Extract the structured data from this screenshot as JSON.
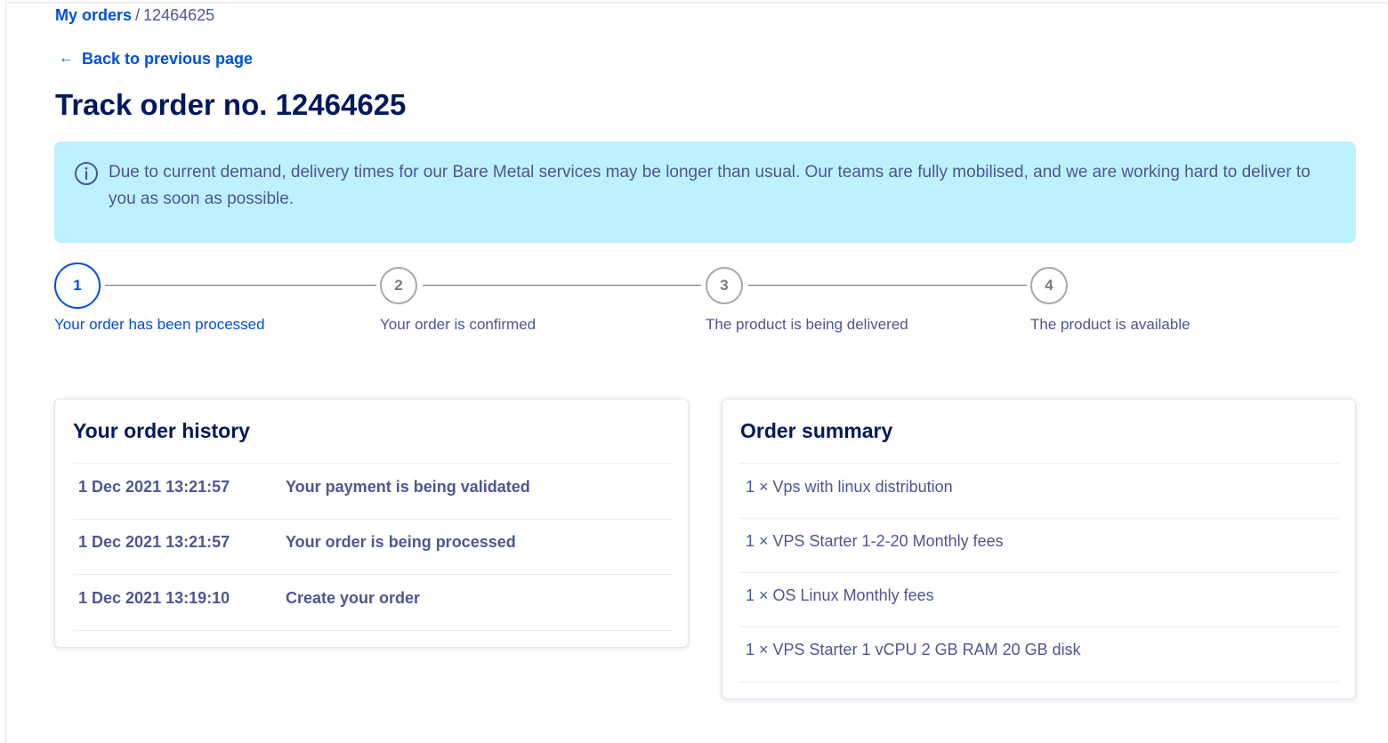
{
  "breadcrumb": {
    "root": "My orders",
    "separator": "/",
    "current": "12464625"
  },
  "back_link": {
    "icon": "arrow-left-icon",
    "label": "Back to previous page"
  },
  "page_title": "Track order no. 12464625",
  "alert": {
    "icon": "info-icon",
    "text": "Due to current demand, delivery times for our Bare Metal services may be longer than usual. Our teams are fully mobilised, and we are working hard to deliver to you as soon as possible."
  },
  "stepper": {
    "current_step": 1,
    "steps": [
      {
        "number": "1",
        "label": "Your order has been processed"
      },
      {
        "number": "2",
        "label": "Your order is confirmed"
      },
      {
        "number": "3",
        "label": "The product is being delivered"
      },
      {
        "number": "4",
        "label": "The product is available"
      }
    ]
  },
  "history": {
    "title": "Your order history",
    "rows": [
      {
        "date": "1 Dec 2021 13:21:57",
        "event": "Your payment is being validated"
      },
      {
        "date": "1 Dec 2021 13:21:57",
        "event": "Your order is being processed"
      },
      {
        "date": "1 Dec 2021 13:19:10",
        "event": "Create your order"
      }
    ]
  },
  "summary": {
    "title": "Order summary",
    "items": [
      "1 × Vps with linux distribution",
      "1 × VPS Starter 1-2-20 Monthly fees",
      "1 × OS Linux Monthly fees",
      "1 × VPS Starter 1 vCPU 2 GB RAM 20 GB disk"
    ]
  },
  "colors": {
    "accent": "#0050d7",
    "title": "#00185e",
    "text": "#4d5693",
    "alert_bg": "#bef1ff"
  }
}
